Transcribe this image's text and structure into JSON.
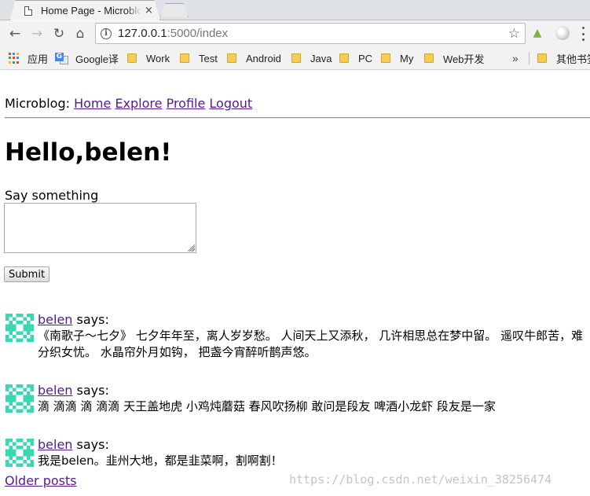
{
  "browser": {
    "tab_title": "Home Page - Microblog",
    "tab_close": "×",
    "url_host": "127.0.0.1",
    "url_path": ":5000/index",
    "nav_back": "←",
    "nav_forward": "→",
    "nav_reload": "↻",
    "nav_home": "⌂",
    "star": "☆"
  },
  "bookmarks": {
    "items": [
      {
        "label": "应用"
      },
      {
        "label": "Google译"
      },
      {
        "label": "Work"
      },
      {
        "label": "Test"
      },
      {
        "label": "Android"
      },
      {
        "label": "Java"
      },
      {
        "label": "PC"
      },
      {
        "label": "My"
      },
      {
        "label": "Web开发"
      }
    ],
    "overflow": "»",
    "other": "其他书签",
    "apps_colors": [
      "#ea4335",
      "#4285f4",
      "#fbbc05",
      "#34a853",
      "#ea4335",
      "#4285f4",
      "#fbbc05",
      "#34a853",
      "#ea4335"
    ]
  },
  "nav": {
    "brand": "Microblog: ",
    "links": [
      "Home",
      "Explore",
      "Profile",
      "Logout"
    ]
  },
  "main": {
    "greeting": "Hello,belen!",
    "say_label": "Say something",
    "post_value": "",
    "submit_label": "Submit"
  },
  "posts": [
    {
      "author": "belen",
      "says": " says:",
      "body": "《南歌子～七夕》 七夕年年至，离人岁岁愁。 人间天上又添秋， 几许相思总在梦中留。 遥叹牛郎苦，难分织女忧。 水晶帘外月如钩， 把盏今宵醉听鹊声悠。"
    },
    {
      "author": "belen",
      "says": " says:",
      "body": "滴 滴滴 滴 滴滴 天王盖地虎 小鸡炖蘑菇 春风吹扬柳 敢问是段友 啤酒小龙虾 段友是一家"
    },
    {
      "author": "belen",
      "says": " says:",
      "body": "我是belen。韭州大地，都是韭菜啊，割啊割！"
    }
  ],
  "pagination": {
    "older": "Older posts"
  },
  "watermark": "https://blog.csdn.net/weixin_38256474",
  "colors": {
    "link_visited": "#551a8b",
    "avatar": "#3ad7b3"
  }
}
